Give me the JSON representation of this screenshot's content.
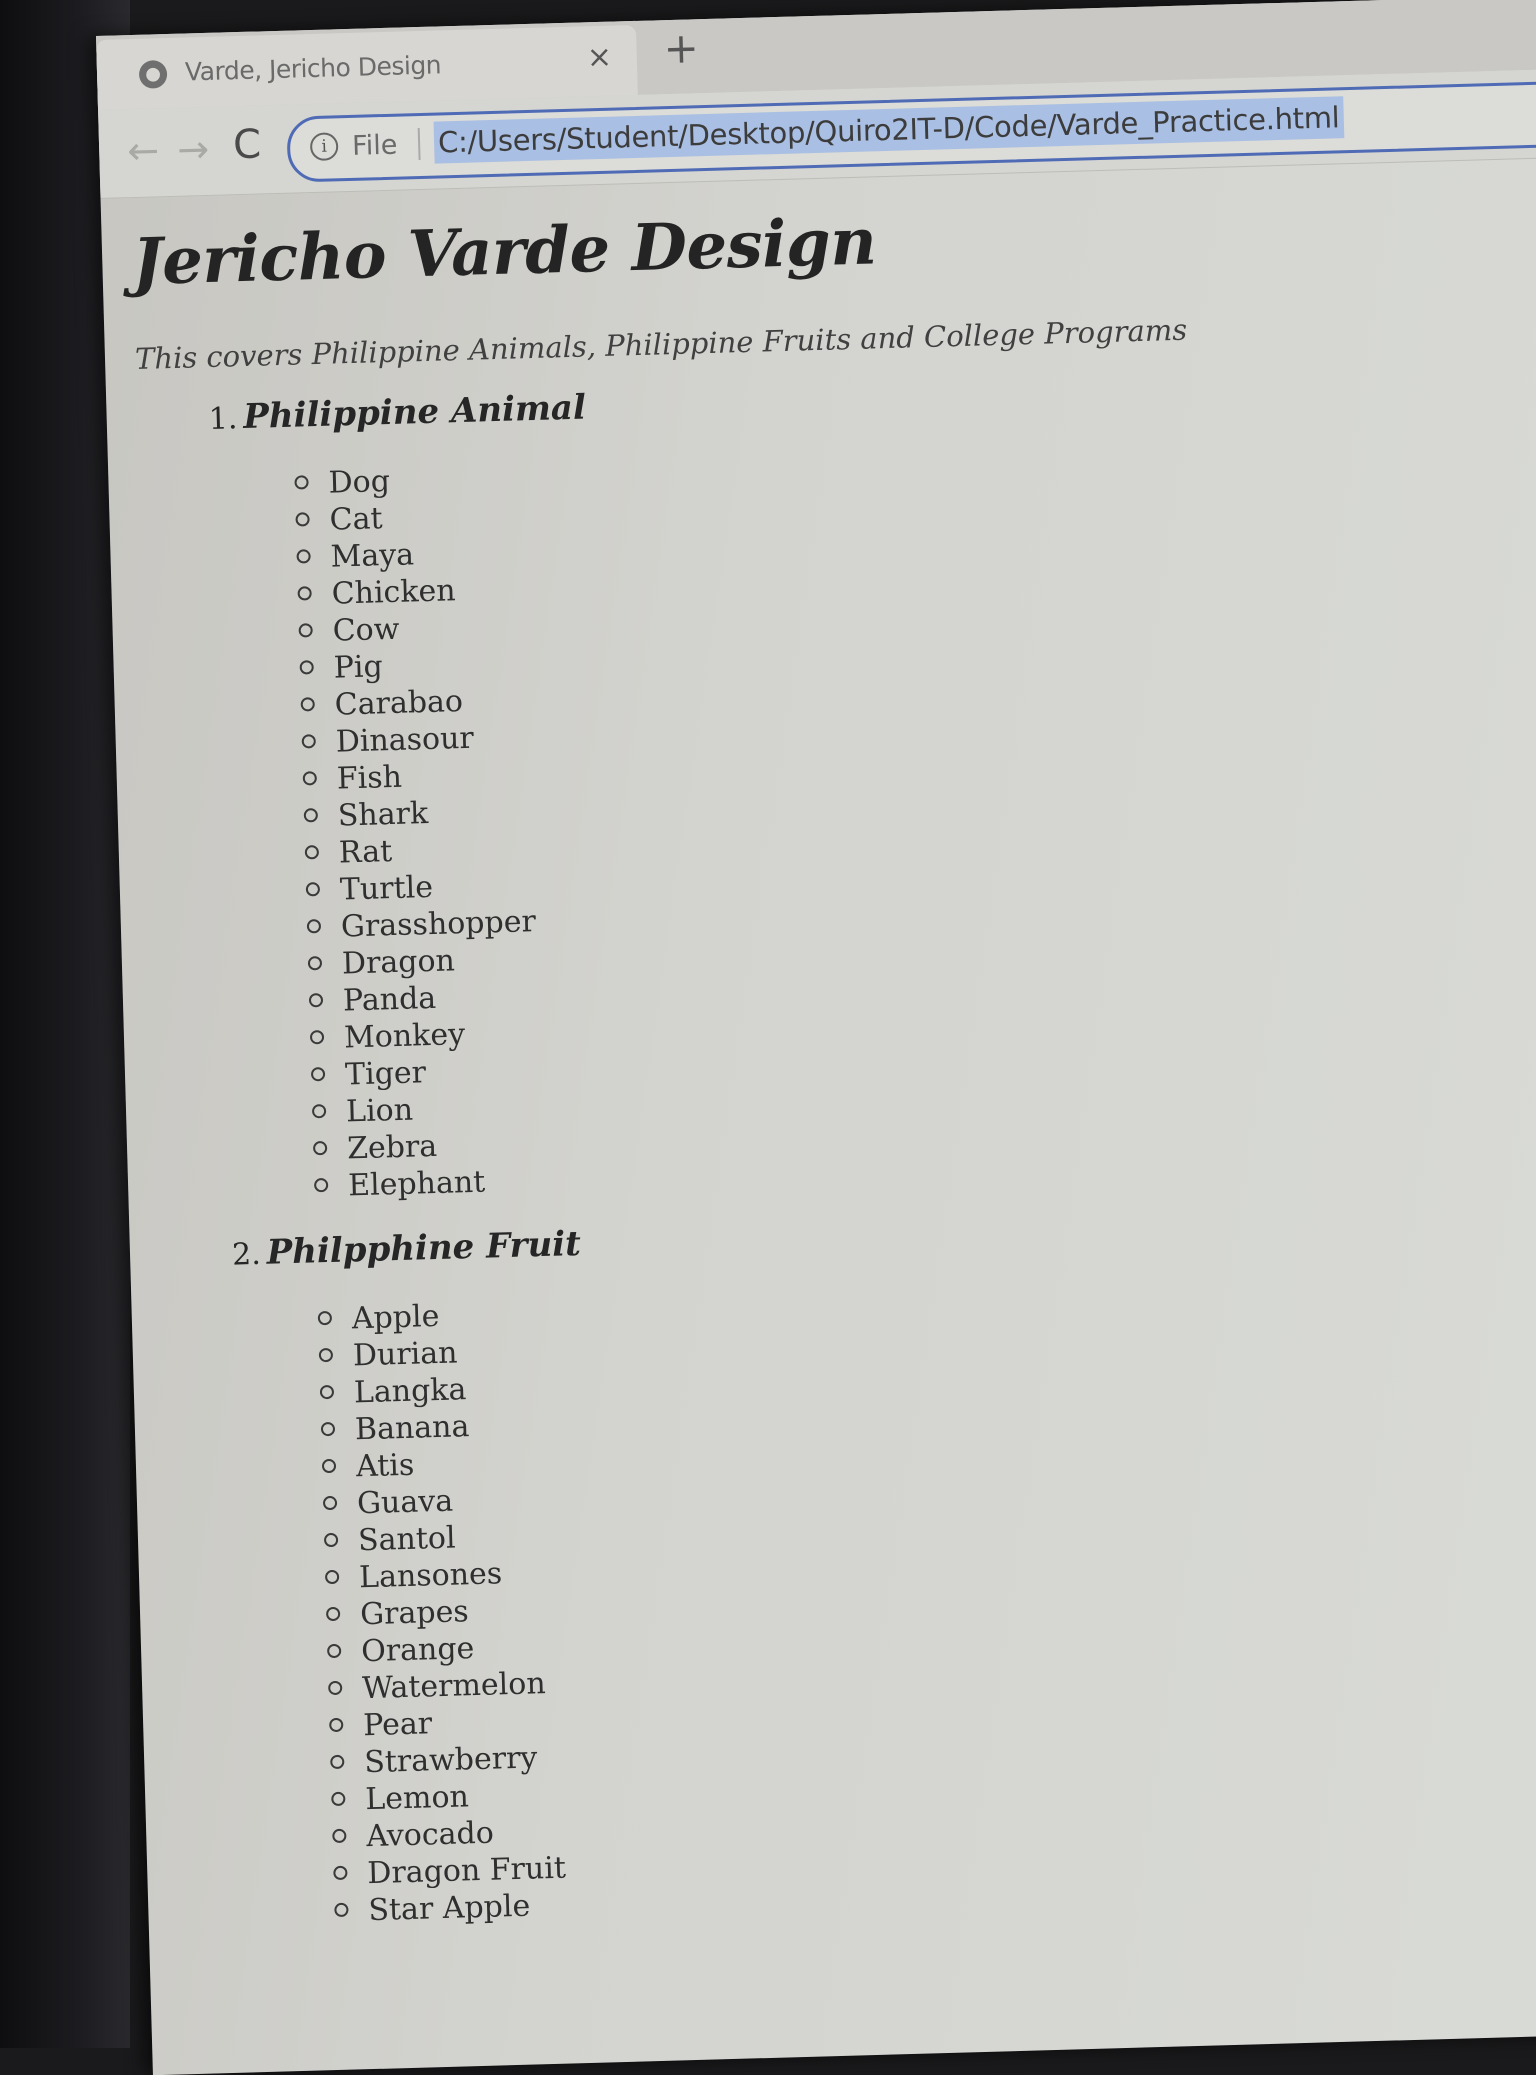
{
  "browser": {
    "tab_title": "Varde, Jericho Design",
    "tab_close": "×",
    "new_tab": "+",
    "back_icon": "←",
    "forward_icon": "→",
    "reload_icon": "C",
    "info_icon": "i",
    "file_label": "File",
    "url": "C:/Users/Student/Desktop/Quiro2IT-D/Code/Varde_Practice.html"
  },
  "page": {
    "title": "Jericho Varde Design",
    "subtitle": "This covers Philippine Animals, Philippine Fruits and College Programs",
    "sections": [
      {
        "number": "1.",
        "heading": "Philippine Animal",
        "items": [
          "Dog",
          "Cat",
          "Maya",
          "Chicken",
          "Cow",
          "Pig",
          "Carabao",
          "Dinasour",
          "Fish",
          "Shark",
          "Rat",
          "Turtle",
          "Grasshopper",
          "Dragon",
          "Panda",
          "Monkey",
          "Tiger",
          "Lion",
          "Zebra",
          "Elephant"
        ]
      },
      {
        "number": "2.",
        "heading": "Philpphine Fruit",
        "items": [
          "Apple",
          "Durian",
          "Langka",
          "Banana",
          "Atis",
          "Guava",
          "Santol",
          "Lansones",
          "Grapes",
          "Orange",
          "Watermelon",
          "Pear",
          "Strawberry",
          "Lemon",
          "Avocado",
          "Dragon Fruit",
          "Star Apple"
        ]
      }
    ]
  }
}
